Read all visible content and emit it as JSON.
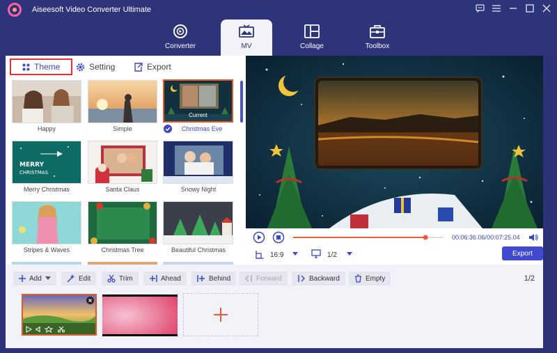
{
  "app": {
    "title": "Aiseesoft Video Converter Ultimate"
  },
  "nav": {
    "tabs": [
      {
        "label": "Converter",
        "icon": "converter-icon"
      },
      {
        "label": "MV",
        "icon": "mv-icon",
        "active": true
      },
      {
        "label": "Collage",
        "icon": "collage-icon"
      },
      {
        "label": "Toolbox",
        "icon": "toolbox-icon"
      }
    ]
  },
  "left_tabs": {
    "theme": "Theme",
    "setting": "Setting",
    "export": "Export"
  },
  "themes": [
    {
      "label": "Happy"
    },
    {
      "label": "Simple"
    },
    {
      "label": "Christmas Eve",
      "badge": "Current",
      "selected": true
    },
    {
      "label": "Merry Christmas"
    },
    {
      "label": "Santa Claus"
    },
    {
      "label": "Snowy Night"
    },
    {
      "label": "Stripes & Waves"
    },
    {
      "label": "Christmas Tree"
    },
    {
      "label": "Beautiful Christmas"
    }
  ],
  "playback": {
    "progress": 0.88,
    "current_time": "00:06:36.06",
    "total_time": "00:07:25.04",
    "aspect_ratio": "16:9",
    "page": "1/2",
    "export_label": "Export"
  },
  "toolbar": {
    "add": "Add",
    "edit": "Edit",
    "trim": "Trim",
    "ahead": "Ahead",
    "behind": "Behind",
    "forward": "Forward",
    "backward": "Backward",
    "empty": "Empty",
    "page_current": "1",
    "page_total": "2"
  },
  "colors": {
    "accent": "#3f4ad0",
    "brand_dark": "#2e3479",
    "highlight_red": "#e0313a",
    "progress_red": "#ee5a3a"
  }
}
